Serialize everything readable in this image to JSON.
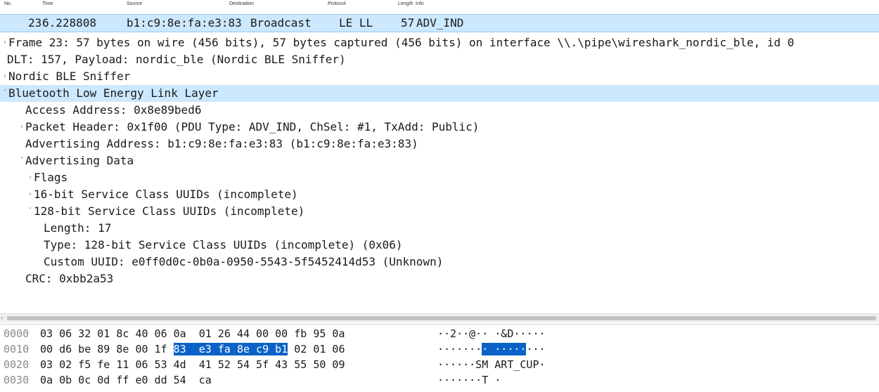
{
  "packet_list": {
    "columns": [
      "No.",
      "Time",
      "Source",
      "Destination",
      "Protocol",
      "Length",
      "Info"
    ],
    "row": {
      "no": "23",
      "time": "6.228808",
      "source": "b1:c9:8e:fa:e3:83",
      "destination": "Broadcast",
      "protocol": "LE LL",
      "length": "57",
      "info": "ADV_IND"
    }
  },
  "details": [
    {
      "expander": "›",
      "text": "Frame 23: 57 bytes on wire (456 bits), 57 bytes captured (456 bits) on interface \\\\.\\pipe\\wireshark_nordic_ble, id 0"
    },
    {
      "expander": "",
      "text": "DLT: 157, Payload: nordic_ble (Nordic BLE Sniffer)"
    },
    {
      "expander": "›",
      "text": "Nordic BLE Sniffer"
    },
    {
      "expander": "˅",
      "text": "Bluetooth Low Energy Link Layer",
      "selected": true
    },
    {
      "expander": "",
      "text": "Access Address: 0x8e89bed6"
    },
    {
      "expander": "›",
      "text": "Packet Header: 0x1f00 (PDU Type: ADV_IND, ChSel: #1, TxAdd: Public)"
    },
    {
      "expander": "",
      "text": "Advertising Address: b1:c9:8e:fa:e3:83 (b1:c9:8e:fa:e3:83)"
    },
    {
      "expander": "˅",
      "text": "Advertising Data"
    },
    {
      "expander": "›",
      "text": "Flags"
    },
    {
      "expander": "›",
      "text": "16-bit Service Class UUIDs (incomplete)"
    },
    {
      "expander": "˅",
      "text": "128-bit Service Class UUIDs (incomplete)"
    },
    {
      "expander": "",
      "text": "Length: 17"
    },
    {
      "expander": "",
      "text": "Type: 128-bit Service Class UUIDs (incomplete) (0x06)"
    },
    {
      "expander": "",
      "text": "Custom UUID: e0ff0d0c-0b0a-0950-5543-5f5452414d53 (Unknown)"
    },
    {
      "expander": "",
      "text": "CRC: 0xbb2a53"
    }
  ],
  "scroll_left_arrow": "‹",
  "bytes": [
    {
      "offset": "0000",
      "hex_pre": "03 06 32 01 8c 40 06 0a  01 26 44 00 00 fb 95 0a",
      "hex_hl": "",
      "hex_post": "",
      "ascii_pre": "··2··@·· ·&D·····",
      "ascii_hl": "",
      "ascii_post": ""
    },
    {
      "offset": "0010",
      "hex_pre": "00 d6 be 89 8e 00 1f ",
      "hex_hl": "83  e3 fa 8e c9 b1",
      "hex_post": " 02 01 06",
      "ascii_pre": "·······",
      "ascii_hl": "· ·····",
      "ascii_post": "···"
    },
    {
      "offset": "0020",
      "hex_pre": "03 02 f5 fe 11 06 53 4d  41 52 54 5f 43 55 50 09",
      "hex_hl": "",
      "hex_post": "",
      "ascii_pre": "······SM ART_CUP·",
      "ascii_hl": "",
      "ascii_post": ""
    },
    {
      "offset": "0030",
      "hex_pre": "0a 0b 0c 0d ff e0 dd 54  ca",
      "hex_hl": "",
      "hex_post": "",
      "ascii_pre": "·······T ·",
      "ascii_hl": "",
      "ascii_post": ""
    }
  ]
}
